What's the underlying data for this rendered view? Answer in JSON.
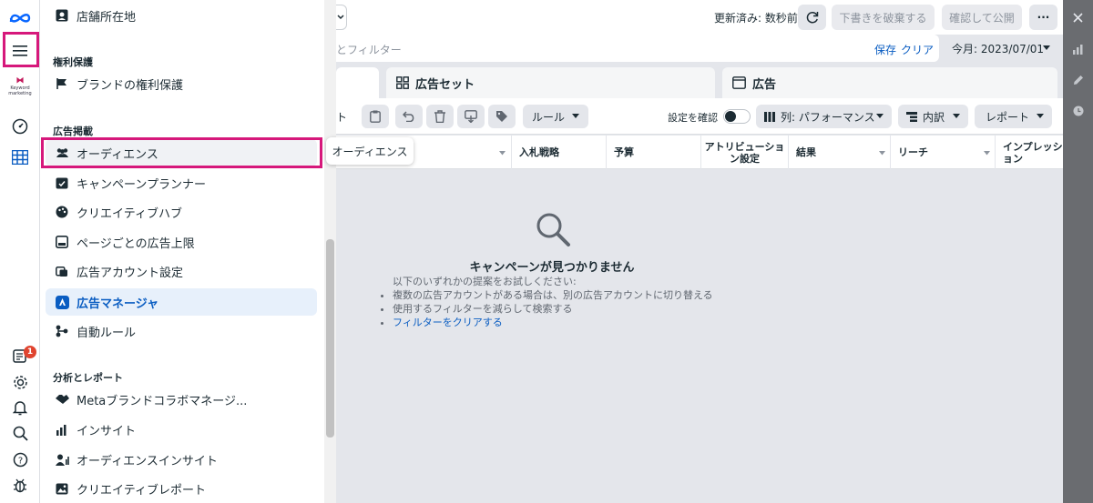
{
  "left_rail": {
    "brand": "meta-logo",
    "keyword_label_1": "Keyword",
    "keyword_label_2": "marketing",
    "notification_count": "1"
  },
  "menu": {
    "top_item": "店舗所在地",
    "sections": [
      {
        "title": "権利保護",
        "items": [
          "ブランドの権利保護"
        ]
      },
      {
        "title": "広告掲載",
        "items": [
          "オーディエンス",
          "キャンペーンプランナー",
          "クリエイティブハブ",
          "ページごとの広告上限",
          "広告アカウント設定",
          "広告マネージャ",
          "自動ルール"
        ]
      },
      {
        "title": "分析とレポート",
        "items": [
          "Metaブランドコラボマネージ...",
          "インサイト",
          "オーディエンスインサイト",
          "クリエイティブレポート"
        ]
      }
    ],
    "active_item": "広告マネージャ",
    "highlighted_item": "オーディエンス"
  },
  "tooltip": "オーディエンス",
  "topbar": {
    "updated": "更新済み: 数秒前",
    "discard": "下書きを破棄する",
    "publish": "確認して公開",
    "more": "···"
  },
  "search": {
    "placeholder": "とフィルター",
    "save": "保存",
    "clear": "クリア",
    "date": "今月: 2023/07/01"
  },
  "tabs": {
    "adsets": "広告セット",
    "ads": "広告"
  },
  "toolbar": {
    "partial": "ト",
    "rules": "ルール",
    "check_settings": "設定を確認",
    "columns": "列: パフォーマンス",
    "breakdown": "内訳",
    "reports": "レポート"
  },
  "table": {
    "headers": [
      "入札戦略",
      "予算",
      "アトリビューション設定",
      "結果",
      "リーチ",
      "インプレッション"
    ]
  },
  "empty_state": {
    "title": "キャンペーンが見つかりません",
    "intro": "以下のいずれかの提案をお試しください:",
    "suggestions": [
      "複数の広告アカウントがある場合は、別の広告アカウントに切り替える",
      "使用するフィルターを減らして検索する"
    ],
    "link": "フィルターをクリアする"
  },
  "colors": {
    "highlight": "#d6187b",
    "accent": "#0a5dc2",
    "active_bg": "#e7f0fb"
  }
}
